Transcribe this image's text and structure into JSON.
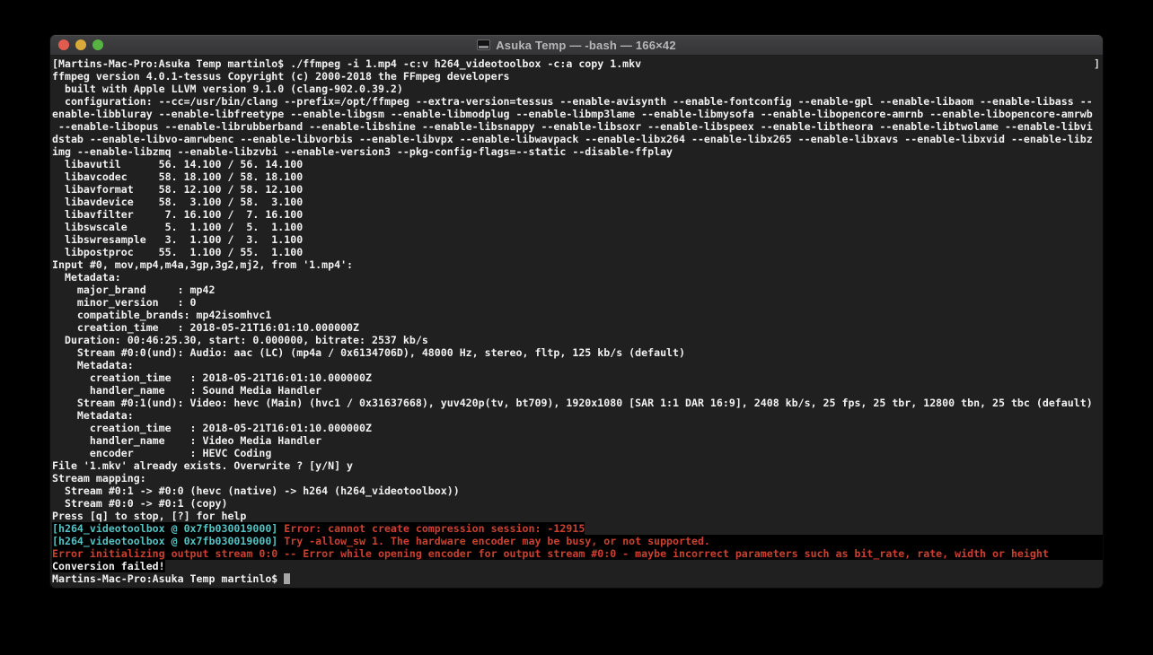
{
  "window": {
    "title": "Asuka Temp — -bash — 166×42",
    "traffic_lights": [
      {
        "name": "close-button",
        "color": "#e25b4e"
      },
      {
        "name": "minimize-button",
        "color": "#d9a93b"
      },
      {
        "name": "zoom-button",
        "color": "#58b442"
      }
    ]
  },
  "terminal": {
    "colors": {
      "background": "#202021",
      "foreground": "#f1f1f1",
      "cyan": "#55c2c4",
      "red": "#cb4030",
      "highlight_background": "#000000",
      "cursor": "#a7a7a7"
    },
    "lines": [
      {
        "s": [
          {
            "t": "["
          },
          {
            "t": "Martins-Mac-Pro:Asuka Temp martinlo$ ./ffmpeg -i 1.mp4 -c:v h264_videotoolbox -c:a copy 1.mkv"
          }
        ],
        "right": "]"
      },
      "ffmpeg version 4.0.1-tessus Copyright (c) 2000-2018 the FFmpeg developers",
      "  built with Apple LLVM version 9.1.0 (clang-902.0.39.2)",
      "  configuration: --cc=/usr/bin/clang --prefix=/opt/ffmpeg --extra-version=tessus --enable-avisynth --enable-fontconfig --enable-gpl --enable-libaom --enable-libass --",
      "enable-libbluray --enable-libfreetype --enable-libgsm --enable-libmodplug --enable-libmp3lame --enable-libmysofa --enable-libopencore-amrnb --enable-libopencore-amrwb",
      " --enable-libopus --enable-librubberband --enable-libshine --enable-libsnappy --enable-libsoxr --enable-libspeex --enable-libtheora --enable-libtwolame --enable-libvi",
      "dstab --enable-libvo-amrwbenc --enable-libvorbis --enable-libvpx --enable-libwavpack --enable-libx264 --enable-libx265 --enable-libxavs --enable-libxvid --enable-libz",
      "img --enable-libzmq --enable-libzvbi --enable-version3 --pkg-config-flags=--static --disable-ffplay",
      "  libavutil      56. 14.100 / 56. 14.100",
      "  libavcodec     58. 18.100 / 58. 18.100",
      "  libavformat    58. 12.100 / 58. 12.100",
      "  libavdevice    58.  3.100 / 58.  3.100",
      "  libavfilter     7. 16.100 /  7. 16.100",
      "  libswscale      5.  1.100 /  5.  1.100",
      "  libswresample   3.  1.100 /  3.  1.100",
      "  libpostproc    55.  1.100 / 55.  1.100",
      "Input #0, mov,mp4,m4a,3gp,3g2,mj2, from '1.mp4':",
      "  Metadata:",
      "    major_brand     : mp42",
      "    minor_version   : 0",
      "    compatible_brands: mp42isomhvc1",
      "    creation_time   : 2018-05-21T16:01:10.000000Z",
      "  Duration: 00:46:25.30, start: 0.000000, bitrate: 2537 kb/s",
      "    Stream #0:0(und): Audio: aac (LC) (mp4a / 0x6134706D), 48000 Hz, stereo, fltp, 125 kb/s (default)",
      "    Metadata:",
      "      creation_time   : 2018-05-21T16:01:10.000000Z",
      "      handler_name    : Sound Media Handler",
      "    Stream #0:1(und): Video: hevc (Main) (hvc1 / 0x31637668), yuv420p(tv, bt709), 1920x1080 [SAR 1:1 DAR 16:9], 2408 kb/s, 25 fps, 25 tbr, 12800 tbn, 25 tbc (default)",
      "    Metadata:",
      "      creation_time   : 2018-05-21T16:01:10.000000Z",
      "      handler_name    : Video Media Handler",
      "      encoder         : HEVC Coding",
      "File '1.mkv' already exists. Overwrite ? [y/N] y",
      "Stream mapping:",
      "  Stream #0:1 -> #0:0 (hevc (native) -> h264 (h264_videotoolbox))",
      "  Stream #0:0 -> #0:1 (copy)",
      "Press [q] to stop, [?] for help",
      {
        "s": [
          {
            "t": "[h264_videotoolbox @ 0x7fb030019000]",
            "c": "cyan",
            "hl": true
          },
          {
            "t": " Error: cannot create compression session: -12915",
            "c": "red",
            "hl": true
          }
        ]
      },
      {
        "bg": "black",
        "s": [
          {
            "t": "[h264_videotoolbox @ 0x7fb030019000]",
            "c": "cyan"
          },
          {
            "t": " Try -allow_sw 1. The hardware encoder may be busy, or not supported.",
            "c": "red"
          }
        ]
      },
      {
        "bg": "black",
        "s": [
          {
            "t": "Error initializing output stream 0:0 -- Error while opening encoder for output stream #0:0 - maybe incorrect parameters such as bit_rate, rate, width or height",
            "c": "red"
          }
        ]
      },
      {
        "s": [
          {
            "t": "Conversion failed!",
            "hl": true
          }
        ]
      },
      {
        "s": [
          {
            "t": "Martins-Mac-Pro:Asuka Temp martinlo$ "
          }
        ],
        "cursor": true
      }
    ]
  }
}
